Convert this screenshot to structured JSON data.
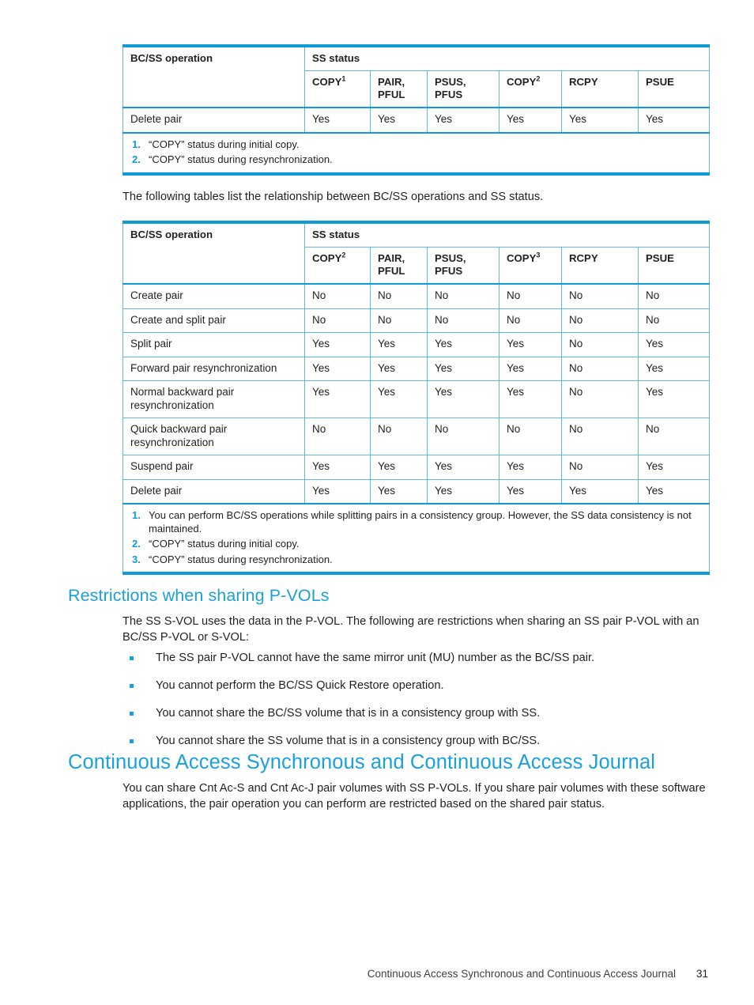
{
  "colors": {
    "heading_blue": "#1ba0dd",
    "table_rule_blue": "#0e9cd8",
    "table_grid_blue": "#5bbce4",
    "body_text": "#231f20"
  },
  "table_top": {
    "name": "bc-ss-operation-vs-ss-status-table-1",
    "row_header_label": "BC/SS operation",
    "group_header_label": "SS status",
    "status_columns": [
      {
        "label": "COPY",
        "sup": "1"
      },
      {
        "label": "PAIR, PFUL",
        "sup": ""
      },
      {
        "label": "PSUS, PFUS",
        "sup": ""
      },
      {
        "label": "COPY",
        "sup": "2"
      },
      {
        "label": "RCPY",
        "sup": ""
      },
      {
        "label": "PSUE",
        "sup": ""
      }
    ],
    "rows": [
      {
        "operation": "Delete pair",
        "values": [
          "Yes",
          "Yes",
          "Yes",
          "Yes",
          "Yes",
          "Yes"
        ]
      }
    ],
    "footnotes": [
      {
        "num": "1.",
        "text": "“COPY” status during initial copy."
      },
      {
        "num": "2.",
        "text": "“COPY” status during resynchronization."
      }
    ]
  },
  "intro_paragraph": "The following tables list the relationship between BC/SS operations and SS status.",
  "table_main": {
    "name": "bc-ss-operation-vs-ss-status-table-2",
    "row_header_label": "BC/SS operation",
    "group_header_label": "SS status",
    "status_columns": [
      {
        "label": "COPY",
        "sup": "2"
      },
      {
        "label": "PAIR, PFUL",
        "sup": ""
      },
      {
        "label": "PSUS, PFUS",
        "sup": ""
      },
      {
        "label": "COPY",
        "sup": "3"
      },
      {
        "label": "RCPY",
        "sup": ""
      },
      {
        "label": "PSUE",
        "sup": ""
      }
    ],
    "rows": [
      {
        "operation": "Create pair",
        "values": [
          "No",
          "No",
          "No",
          "No",
          "No",
          "No"
        ]
      },
      {
        "operation": "Create and split pair",
        "values": [
          "No",
          "No",
          "No",
          "No",
          "No",
          "No"
        ]
      },
      {
        "operation": "Split pair",
        "values": [
          "Yes",
          "Yes",
          "Yes",
          "Yes",
          "No",
          "Yes"
        ]
      },
      {
        "operation": "Forward pair resynchronization",
        "values": [
          "Yes",
          "Yes",
          "Yes",
          "Yes",
          "No",
          "Yes"
        ]
      },
      {
        "operation": "Normal backward pair resynchronization",
        "values": [
          "Yes",
          "Yes",
          "Yes",
          "Yes",
          "No",
          "Yes"
        ]
      },
      {
        "operation": "Quick backward pair resynchronization",
        "values": [
          "No",
          "No",
          "No",
          "No",
          "No",
          "No"
        ]
      },
      {
        "operation": "Suspend pair",
        "values": [
          "Yes",
          "Yes",
          "Yes",
          "Yes",
          "No",
          "Yes"
        ]
      },
      {
        "operation": "Delete pair",
        "values": [
          "Yes",
          "Yes",
          "Yes",
          "Yes",
          "Yes",
          "Yes"
        ]
      }
    ],
    "footnotes": [
      {
        "num": "1.",
        "text": "You can perform BC/SS operations while splitting pairs in a consistency group. However, the SS data consistency is not maintained."
      },
      {
        "num": "2.",
        "text": "“COPY” status during initial copy."
      },
      {
        "num": "3.",
        "text": "“COPY” status during resynchronization."
      }
    ]
  },
  "section_restrictions": {
    "heading": "Restrictions when sharing P-VOLs",
    "paragraph": "The SS S-VOL uses the data in the P-VOL. The following are restrictions when sharing an SS pair P-VOL with an BC/SS P-VOL or S-VOL:",
    "bullets": [
      "The SS pair P-VOL cannot have the same mirror unit (MU) number as the BC/SS pair.",
      "You cannot perform the BC/SS Quick Restore operation.",
      "You cannot share the BC/SS volume that is in a consistency group with SS.",
      "You cannot share the SS volume that is in a consistency group with BC/SS."
    ]
  },
  "section_continuous_access": {
    "heading": "Continuous Access Synchronous and Continuous Access Journal",
    "paragraph": "You can share Cnt Ac-S and Cnt Ac-J pair volumes with SS P-VOLs. If you share pair volumes with these software applications, the pair operation you can perform are restricted based on the shared pair status."
  },
  "footer": {
    "running_head": "Continuous Access Synchronous and Continuous Access Journal",
    "page_number": "31"
  }
}
